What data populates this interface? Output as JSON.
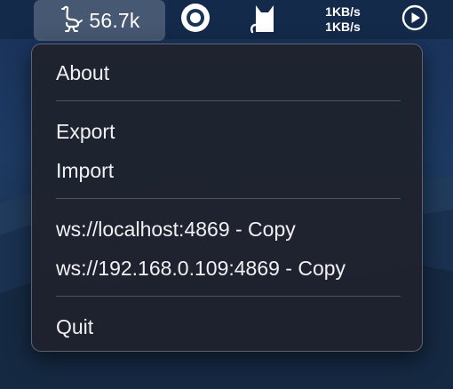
{
  "menubar": {
    "ostrich_count": "56.7k",
    "speed_up": "1KB/s",
    "speed_down": "1KB/s",
    "icons": {
      "app_icon": "ostrich-icon",
      "target_icon": "target-icon",
      "cat_icon": "cat-icon",
      "play_icon": "play-circle-icon"
    }
  },
  "menu": {
    "items": [
      {
        "label": "About"
      },
      {
        "label": "Export"
      },
      {
        "label": "Import"
      },
      {
        "label": "ws://localhost:4869 - Copy"
      },
      {
        "label": "ws://192.168.0.109:4869 - Copy"
      },
      {
        "label": "Quit"
      }
    ]
  },
  "colors": {
    "menu_background": "#1e222e",
    "menubar_background": "#142848",
    "text": "#f1f1f3"
  }
}
